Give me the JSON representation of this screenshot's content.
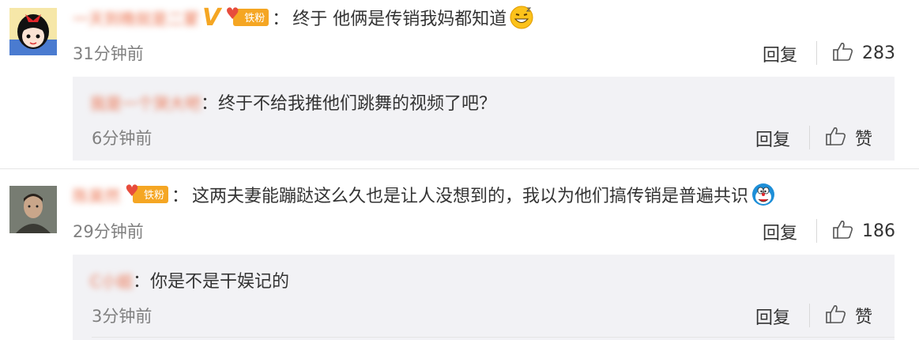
{
  "comments": [
    {
      "user": "一天到晚就是二蒙",
      "separator": "：",
      "text": "终于 他俩是传销我妈都知道",
      "time": "31分钟前",
      "reply_label": "回复",
      "like_count": "283",
      "badge": "铁粉",
      "reply": {
        "user": "我是一个哭大吧",
        "separator": "：",
        "text": "终于不给我推他们跳舞的视频了吧？",
        "time": "6分钟前",
        "reply_label": "回复",
        "like_label": "赞"
      }
    },
    {
      "user": "陈昊然",
      "separator": "：",
      "text": "这两夫妻能蹦跶这么久也是让人没想到的，我以为他们搞传销是普遍共识",
      "time": "29分钟前",
      "reply_label": "回复",
      "like_count": "186",
      "badge": "铁粉",
      "reply": {
        "user": "C小姐",
        "separator": "：",
        "text": "你是不是干娱记的",
        "time": "3分钟前",
        "reply_label": "回复",
        "like_label": "赞"
      }
    }
  ],
  "colors": {
    "username": "#eb7350",
    "time": "#808080",
    "reply_bg": "#f2f2f5",
    "badge": "#f5a623"
  },
  "icons": [
    "thumbs-up-icon",
    "heart-icon",
    "grinning-emoji-icon",
    "doraemon-emoji-icon"
  ]
}
